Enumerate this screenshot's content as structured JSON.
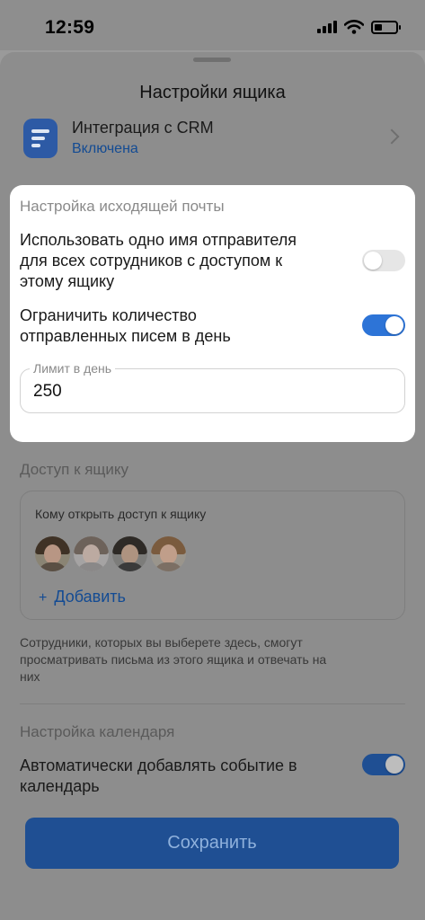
{
  "status_bar": {
    "time": "12:59"
  },
  "sheet": {
    "title": "Настройки ящика",
    "crm": {
      "title": "Интеграция с CRM",
      "status": "Включена"
    }
  },
  "outgoing": {
    "heading": "Настройка исходящей почты",
    "same_sender": {
      "lines": [
        "Использовать одно имя отправителя",
        "для всех сотрудников с доступом к",
        "этому ящику"
      ],
      "enabled": false
    },
    "limit_sent": {
      "lines": [
        "Ограничить количество",
        "отправленных писем в день"
      ],
      "enabled": true
    },
    "daily_limit": {
      "label": "Лимит в день",
      "value": "250"
    }
  },
  "access": {
    "heading": "Доступ к ящику",
    "prompt": "Кому открыть доступ к ящику",
    "add_label": "Добавить",
    "add_symbol": "+",
    "note_lines": [
      "Сотрудники, которых вы выберете здесь, смогут",
      "просматривать письма из этого ящика и отвечать на",
      "них"
    ]
  },
  "calendar": {
    "heading": "Настройка календаря",
    "auto_event": {
      "lines": [
        "Автоматически добавлять событие в",
        "календарь"
      ],
      "enabled": true
    }
  },
  "actions": {
    "save_label": "Сохранить"
  },
  "colors": {
    "accent": "#2d74d7",
    "link": "#134b93",
    "save_button": "#1f4f93",
    "overlay": "#8d8d8d"
  },
  "icons": [
    "signal-icon",
    "wifi-icon",
    "battery-icon",
    "crm-icon",
    "chevron-right-icon",
    "plus-icon"
  ]
}
